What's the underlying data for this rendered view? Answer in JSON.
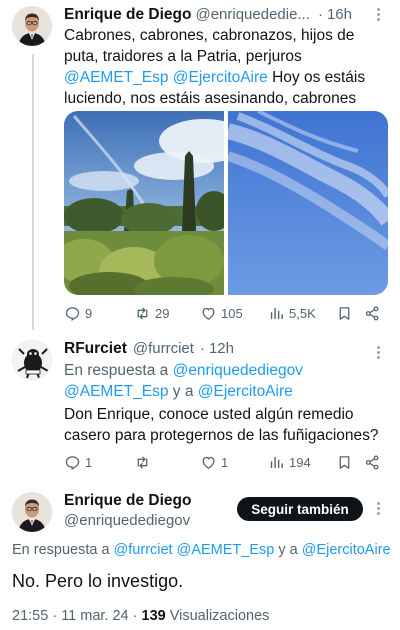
{
  "tweet1": {
    "display_name": "Enrique de Diego",
    "handle": "@enriquedediegov",
    "handle_shown": "@enriquededie...",
    "separator": "·",
    "time": "16h",
    "text_line1": "Cabrones, cabrones, cabronazos, hijos de",
    "text_line2": "puta, traidores a la Patria, perjuros",
    "mention1": "@AEMET_Esp",
    "mention2": "@EjercitoAire",
    "text_line3_tail": " Hoy os estáis",
    "text_line4": "luciendo, nos estáis asesinando, cabrones",
    "media": [
      "photo-trees-sky",
      "photo-blue-sky-trails"
    ],
    "actions": {
      "replies": "9",
      "retweets": "29",
      "likes": "105",
      "views": "5,5K"
    }
  },
  "tweet2": {
    "display_name": "RFurciet",
    "handle": "@furrciet",
    "separator": "·",
    "time": "12h",
    "reply_prefix": "En respuesta a",
    "reply_to1": "@enriquedediegov",
    "reply_to2": "@AEMET_Esp",
    "reply_and": " y a ",
    "reply_to3": "@EjercitoAire",
    "text_line1": "Don Enrique, conoce usted algún remedio",
    "text_line2": "casero para protegernos de las fuñigaciones?",
    "actions": {
      "replies": "1",
      "retweets": "",
      "likes": "1",
      "views": "194"
    }
  },
  "main_tweet": {
    "display_name": "Enrique de Diego",
    "handle": "@enriquedediegov",
    "follow_label": "Seguir también",
    "reply_prefix": "En respuesta a",
    "reply_to1": "@furrciet",
    "reply_to2": "@AEMET_Esp",
    "reply_and": " y a ",
    "reply_to3": "@EjercitoAire",
    "text": "No. Pero lo investigo.",
    "time": "21:55",
    "date_sep": " · ",
    "date": "11 mar. 24",
    "views_count": "139",
    "views_label": "Visualizaciones"
  },
  "colors": {
    "accent": "#1d9bf0",
    "text": "#0f1419",
    "muted": "#536471",
    "follow_bg": "#0f1419"
  }
}
